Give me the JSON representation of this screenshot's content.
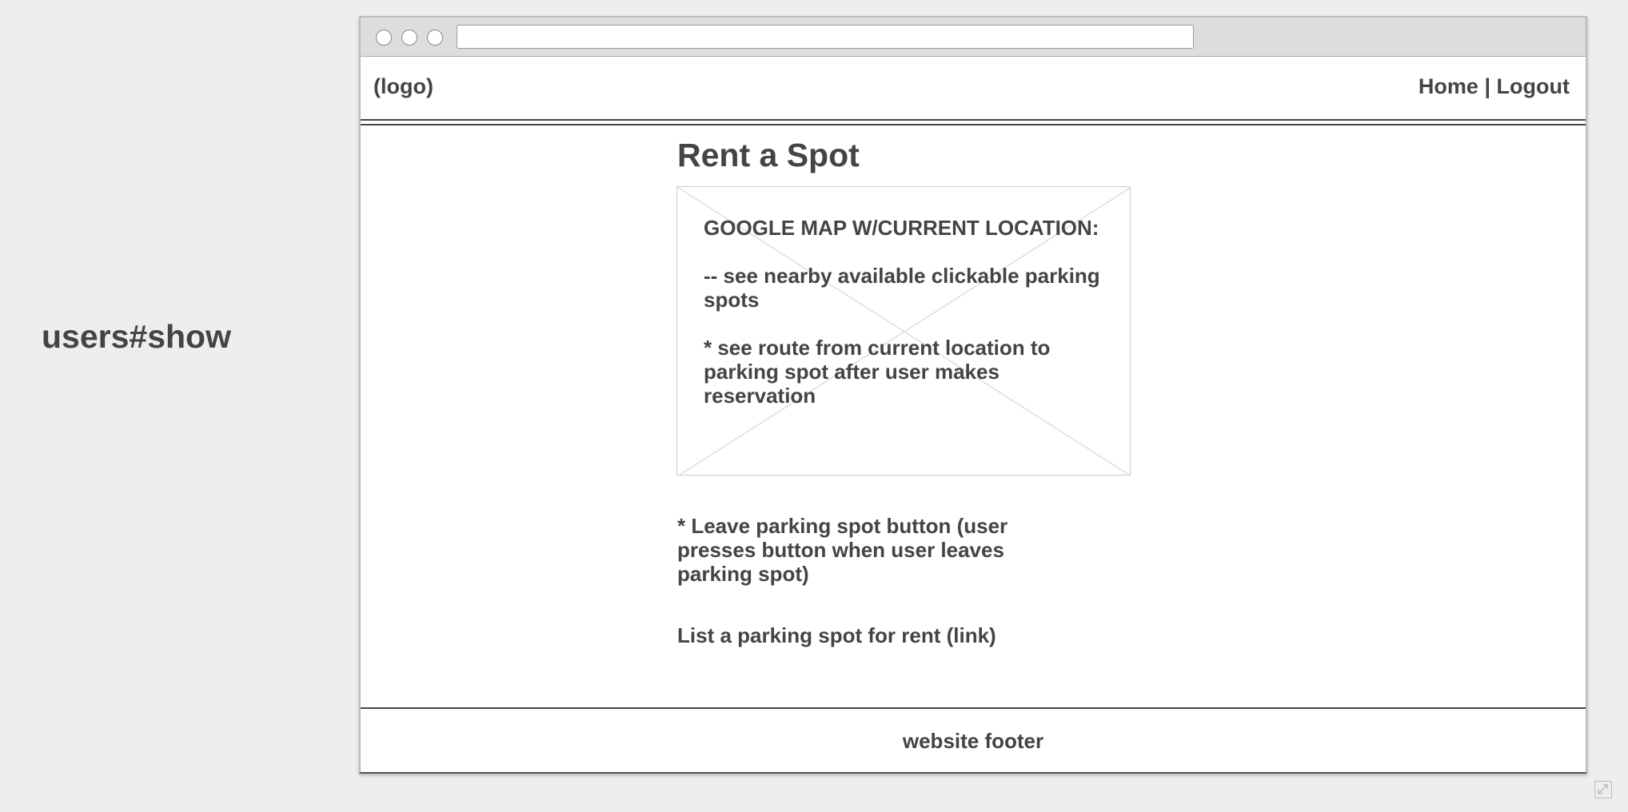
{
  "page_label": "users#show",
  "browser": {
    "address_bar_value": ""
  },
  "header": {
    "logo": "(logo)",
    "nav": {
      "home": "Home",
      "separator": "|",
      "logout": "Logout"
    }
  },
  "main": {
    "title": "Rent a Spot",
    "map_placeholder": {
      "heading": "GOOGLE MAP W/CURRENT LOCATION:",
      "line1": "-- see nearby available clickable parking spots",
      "line2": "* see route from current location to parking spot after user makes reservation"
    },
    "leave_spot_note": "* Leave parking spot button (user presses button when user leaves parking spot)",
    "list_spot_link": "List a parking spot for rent (link)"
  },
  "footer": {
    "text": "website footer"
  },
  "icons": {
    "window_buttons": [
      "circle-icon",
      "circle-icon",
      "circle-icon"
    ],
    "resize": "expand-icon"
  }
}
